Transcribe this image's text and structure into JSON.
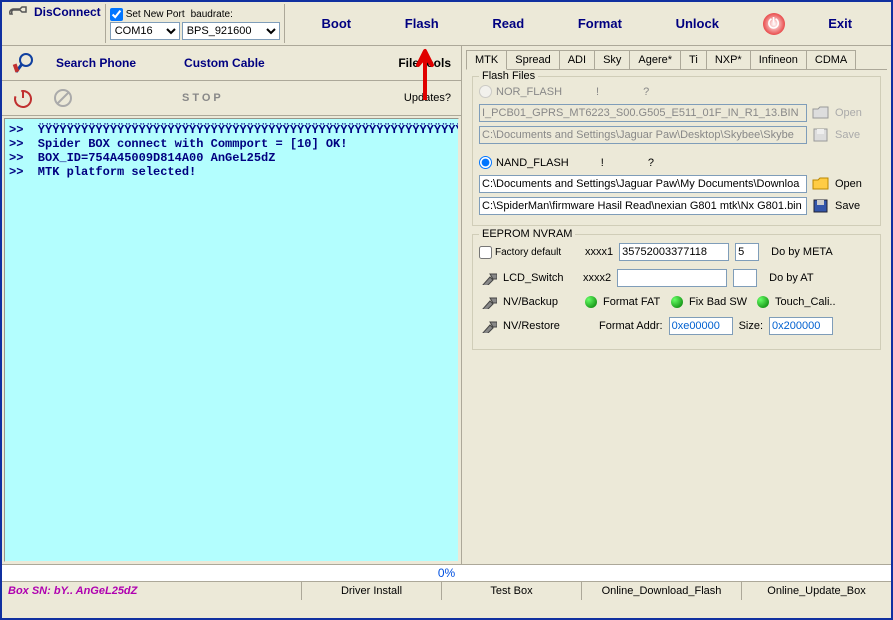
{
  "toolbar": {
    "disconnect": "DisConnect",
    "setNewPort": "Set New Port",
    "baudrate": "baudrate:",
    "port": "COM16",
    "baud": "BPS_921600",
    "nav": [
      "Boot",
      "Flash",
      "Read",
      "Format",
      "Unlock",
      "Exit"
    ]
  },
  "left": {
    "searchPhone": "Search Phone",
    "customCable": "Custom Cable",
    "fileTools": "File tools",
    "stop": "STOP",
    "updates": "Updates?"
  },
  "log": ">>  ŸŸŸŸŸŸŸŸŸŸŸŸŸŸŸŸŸŸŸŸŸŸŸŸŸŸŸŸŸŸŸŸŸŸŸŸŸŸŸŸŸŸŸŸŸŸŸŸŸŸŸŸŸŸŸŸŸŸŸŸŸŸŸŸ\n>>  Spider BOX connect with Commport = [10] OK!\n>>  BOX_ID=754A45009D814A00 AnGeL25dZ\n>>  MTK platform selected!",
  "tabs": [
    "MTK",
    "Spread",
    "ADI",
    "Sky",
    "Agere*",
    "Ti",
    "NXP*",
    "Infineon",
    "CDMA"
  ],
  "flashFiles": {
    "title": "Flash Files",
    "norLabel": "NOR_FLASH",
    "nandLabel": "NAND_FLASH",
    "q1": "!",
    "q2": "?",
    "path1": "I_PCB01_GPRS_MT6223_S00.G505_E511_01F_IN_R1_13.BIN",
    "path2": "C:\\Documents and Settings\\Jaguar Paw\\Desktop\\Skybee\\Skybe",
    "path3": "C:\\Documents and Settings\\Jaguar Paw\\My Documents\\Downloa",
    "path4": "C:\\SpiderMan\\firmware Hasil Read\\nexian G801 mtk\\Nx G801.bin",
    "open": "Open",
    "save": "Save"
  },
  "eeprom": {
    "title": "EEPROM NVRAM",
    "factoryDefault": "Factory default",
    "xxxx1": "xxxx1",
    "xxxx2": "xxxx2",
    "val1": "35752003377118",
    "val1b": "5",
    "doByMeta": "Do by META",
    "doByAt": "Do by AT",
    "lcdSwitch": "LCD_Switch",
    "nvBackup": "NV/Backup",
    "nvRestore": "NV/Restore",
    "formatFat": "Format FAT",
    "fixBadSw": "Fix Bad SW",
    "touchCali": "Touch_Cali..",
    "formatAddr": "Format Addr:",
    "formatAddrVal": "0xe00000",
    "size": "Size:",
    "sizeVal": "0x200000"
  },
  "progress": "0%",
  "bottom": {
    "boxSn": "Box SN: bY.. AnGeL25dZ",
    "driverInstall": "Driver Install",
    "testBox": "Test Box",
    "onlineDownload": "Online_Download_Flash",
    "onlineUpdate": "Online_Update_Box"
  }
}
